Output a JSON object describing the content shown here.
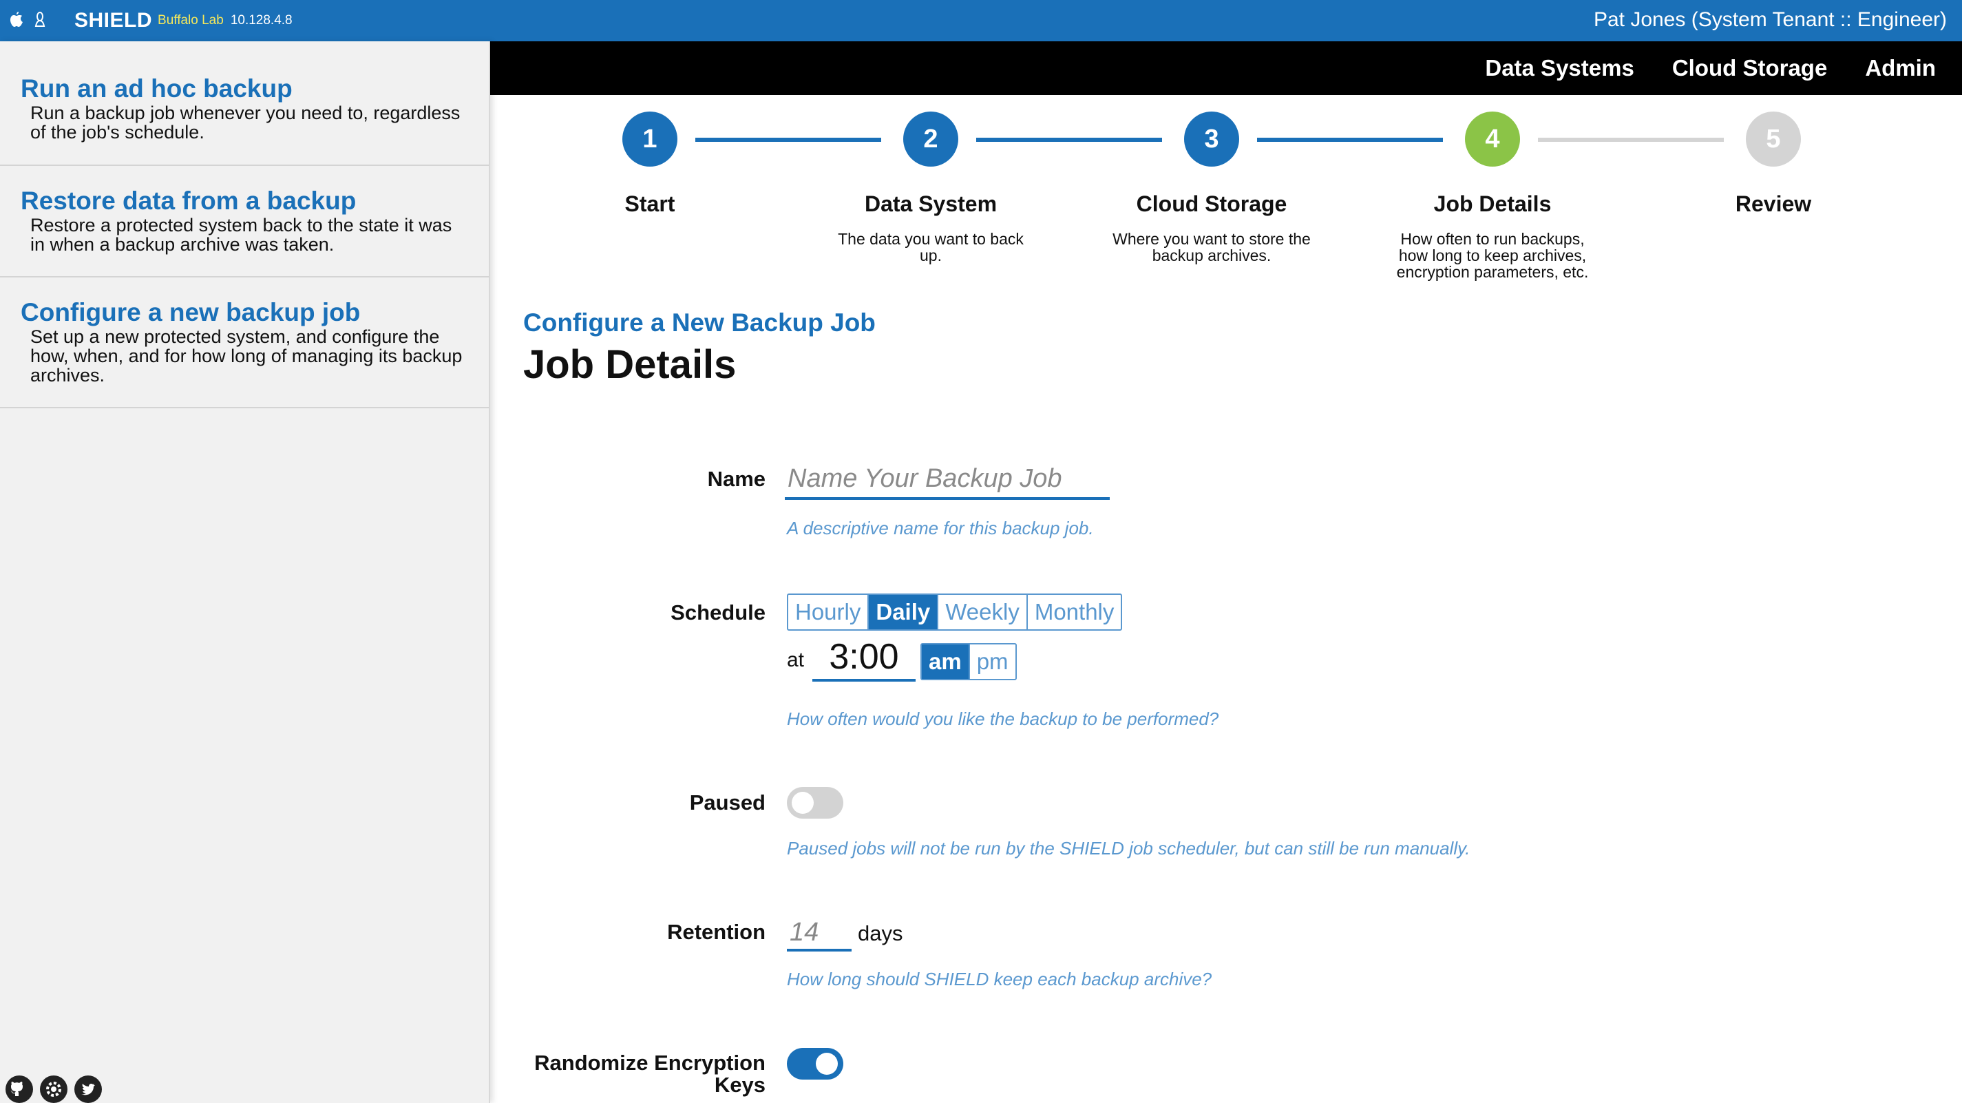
{
  "topbar": {
    "brand": "SHIELD",
    "environment": "Buffalo Lab",
    "ip": "10.128.4.8",
    "user": "Pat Jones (System Tenant :: Engineer)",
    "icons": [
      "apple-icon",
      "linux-icon"
    ]
  },
  "nav": {
    "items": [
      "Data Systems",
      "Cloud Storage",
      "Admin"
    ]
  },
  "sidebar": {
    "items": [
      {
        "title": "Run an ad hoc backup",
        "desc": "Run a backup job whenever you need to, regardless of the job's schedule."
      },
      {
        "title": "Restore data from a backup",
        "desc": "Restore a protected system back to the state it was in when a backup archive was taken."
      },
      {
        "title": "Configure a new backup job",
        "desc": "Set up a new protected system, and configure the how, when, and for how long of managing its backup archives."
      }
    ],
    "footer_icons": [
      "github-icon",
      "settings-icon",
      "twitter-icon"
    ]
  },
  "wizard": {
    "current_step": 4,
    "steps": [
      {
        "num": "1",
        "title": "Start",
        "desc": ""
      },
      {
        "num": "2",
        "title": "Data System",
        "desc": "The data you want to back up."
      },
      {
        "num": "3",
        "title": "Cloud Storage",
        "desc": "Where you want to store the backup archives."
      },
      {
        "num": "4",
        "title": "Job Details",
        "desc": "How often to run backups, how long to keep archives, encryption parameters, etc."
      },
      {
        "num": "5",
        "title": "Review",
        "desc": ""
      }
    ],
    "colors": {
      "done": "#1a70b8",
      "current": "#8bc447",
      "todo": "#d4d4d4"
    }
  },
  "page": {
    "subtitle": "Configure a New Backup Job",
    "title": "Job Details"
  },
  "form": {
    "name": {
      "label": "Name",
      "placeholder": "Name Your Backup Job",
      "value": "",
      "help": "A descriptive name for this backup job."
    },
    "schedule": {
      "label": "Schedule",
      "options": [
        "Hourly",
        "Daily",
        "Weekly",
        "Monthly"
      ],
      "selected": "Daily",
      "at_label": "at",
      "time": "3:00",
      "ampm_options": [
        "am",
        "pm"
      ],
      "ampm_selected": "am",
      "help": "How often would you like the backup to be performed?"
    },
    "paused": {
      "label": "Paused",
      "value": false,
      "help": "Paused jobs will not be run by the SHIELD job scheduler, but can still be run manually."
    },
    "retention": {
      "label": "Retention",
      "value": "14",
      "unit": "days",
      "help": "How long should SHIELD keep each backup archive?"
    },
    "randomize": {
      "label": "Randomize Encryption Keys",
      "value": true
    }
  },
  "colors": {
    "brand_blue": "#1a70b8",
    "help_text": "#5a98cf",
    "success_green": "#8bc447"
  }
}
